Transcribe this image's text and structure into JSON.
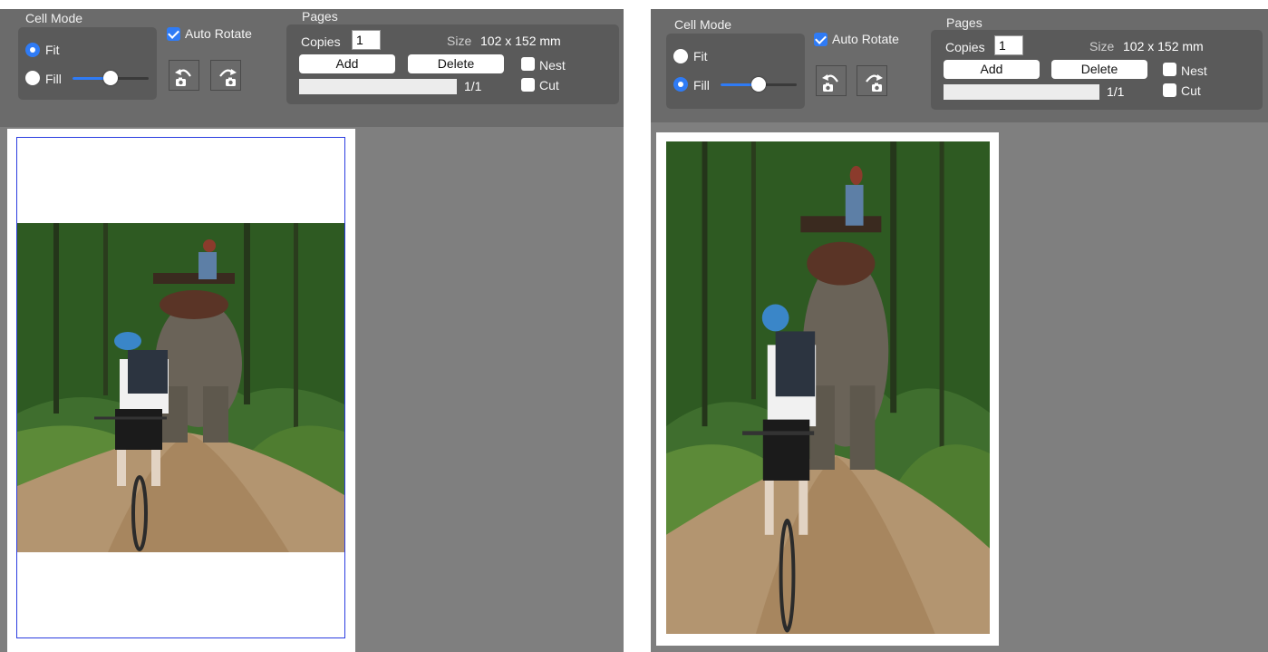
{
  "panels": [
    {
      "cell_mode": {
        "title": "Cell Mode",
        "fit_label": "Fit",
        "fill_label": "Fill",
        "selected": "Fit",
        "slider_level": 0.5
      },
      "auto_rotate": {
        "label": "Auto Rotate",
        "checked": true
      },
      "rotate_buttons": [
        "rotate-left-camera-icon",
        "rotate-right-camera-icon"
      ],
      "pages": {
        "title": "Pages",
        "copies_label": "Copies",
        "copies_value": "1",
        "size_label": "Size",
        "size_value": "102 x 152 mm",
        "add_label": "Add",
        "delete_label": "Delete",
        "nest_label": "Nest",
        "nest_checked": false,
        "cut_label": "Cut",
        "cut_checked": false,
        "page_counter": "1/1"
      }
    },
    {
      "cell_mode": {
        "title": "Cell Mode",
        "fit_label": "Fit",
        "fill_label": "Fill",
        "selected": "Fill",
        "slider_level": 0.5
      },
      "auto_rotate": {
        "label": "Auto Rotate",
        "checked": true
      },
      "rotate_buttons": [
        "rotate-left-camera-icon",
        "rotate-right-camera-icon"
      ],
      "pages": {
        "title": "Pages",
        "copies_label": "Copies",
        "copies_value": "1",
        "size_label": "Size",
        "size_value": "102 x 152 mm",
        "add_label": "Add",
        "delete_label": "Delete",
        "nest_label": "Nest",
        "nest_checked": false,
        "cut_label": "Cut",
        "cut_checked": false,
        "page_counter": "1/1"
      }
    }
  ],
  "colors": {
    "accent": "#2f7bf5",
    "toolbar": "#6b6b6b",
    "group": "#5a5a5a",
    "canvas": "#7f7f7f",
    "cell_border": "#2b3de0"
  }
}
